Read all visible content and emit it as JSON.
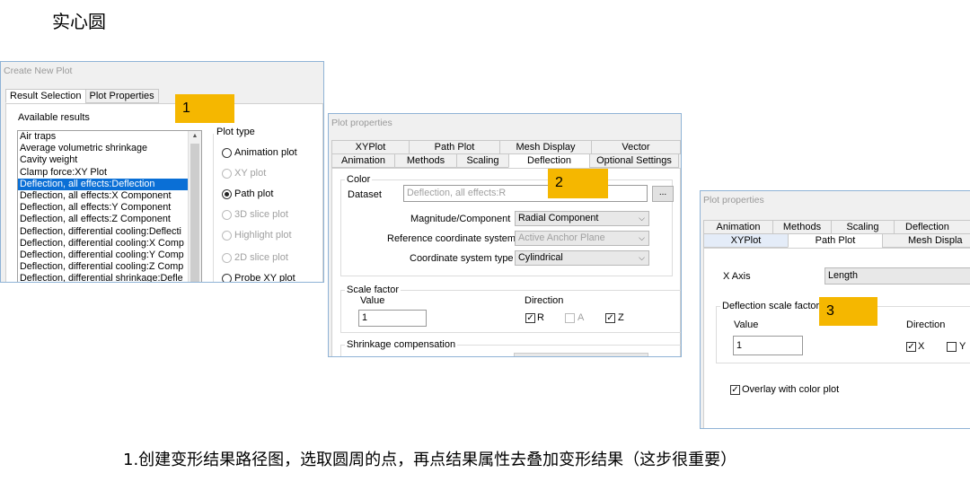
{
  "page_title": "实心圆",
  "caption": "1.创建变形结果路径图，选取圆周的点，再点结果属性去叠加变形结果（这步很重要）",
  "colors": {
    "marker": "#f5b700",
    "selection": "#0a6fd6",
    "window_border": "#8fb3d6"
  },
  "markers": [
    "1",
    "2",
    "3"
  ],
  "dialog1": {
    "title": "Create New Plot",
    "tabs": [
      "Result Selection",
      "Plot Properties"
    ],
    "available_label": "Available results",
    "results": [
      "Air traps",
      "Average volumetric shrinkage",
      "Cavity weight",
      "Clamp force:XY Plot",
      "Deflection, all effects:Deflection",
      "Deflection, all effects:X Component",
      "Deflection, all effects:Y Component",
      "Deflection, all effects:Z Component",
      "Deflection, differential cooling:Deflecti",
      "Deflection, differential cooling:X Comp",
      "Deflection, differential cooling:Y Comp",
      "Deflection, differential cooling:Z Comp",
      "Deflection, differential shrinkage:Defle"
    ],
    "selected_index": 4,
    "plot_type_label": "Plot type",
    "plot_types": [
      {
        "label": "Animation plot",
        "state": "enabled"
      },
      {
        "label": "XY plot",
        "state": "disabled"
      },
      {
        "label": "Path plot",
        "state": "checked"
      },
      {
        "label": "3D slice plot",
        "state": "disabled"
      },
      {
        "label": "Highlight plot",
        "state": "disabled"
      },
      {
        "label": "2D slice plot",
        "state": "disabled"
      },
      {
        "label": "Probe XY plot",
        "state": "enabled"
      }
    ]
  },
  "dialog2": {
    "title": "Plot properties",
    "tabs_row1": [
      "XYPlot",
      "Path Plot",
      "Mesh Display",
      "Vector"
    ],
    "tabs_row2": [
      "Animation",
      "Methods",
      "Scaling",
      "Deflection",
      "Optional Settings"
    ],
    "color_label": "Color",
    "dataset_label": "Dataset",
    "dataset_value": "Deflection, all effects:R",
    "browse_label": "...",
    "magnitude_label": "Magnitude/Component",
    "magnitude_value": "Radial Component",
    "ref_label": "Reference coordinate system",
    "ref_value": "Active Anchor Plane",
    "cs_label": "Coordinate system type",
    "cs_value": "Cylindrical",
    "scale_label": "Scale factor",
    "value_label": "Value",
    "value": "1",
    "direction_label": "Direction",
    "dir_r": "R",
    "dir_a": "A",
    "dir_z": "Z",
    "shrink_label": "Shrinkage compensation"
  },
  "dialog3": {
    "title": "Plot properties",
    "tabs_row1": [
      "Animation",
      "Methods",
      "Scaling",
      "Deflection"
    ],
    "tabs_row2": [
      "XYPlot",
      "Path Plot",
      "Mesh Displa"
    ],
    "xaxis_label": "X Axis",
    "xaxis_value": "Length",
    "dsf_label": "Deflection scale factor",
    "value_label": "Value",
    "value": "1",
    "direction_label": "Direction",
    "dir_x": "X",
    "dir_y": "Y",
    "overlay_label": "Overlay with color plot"
  }
}
